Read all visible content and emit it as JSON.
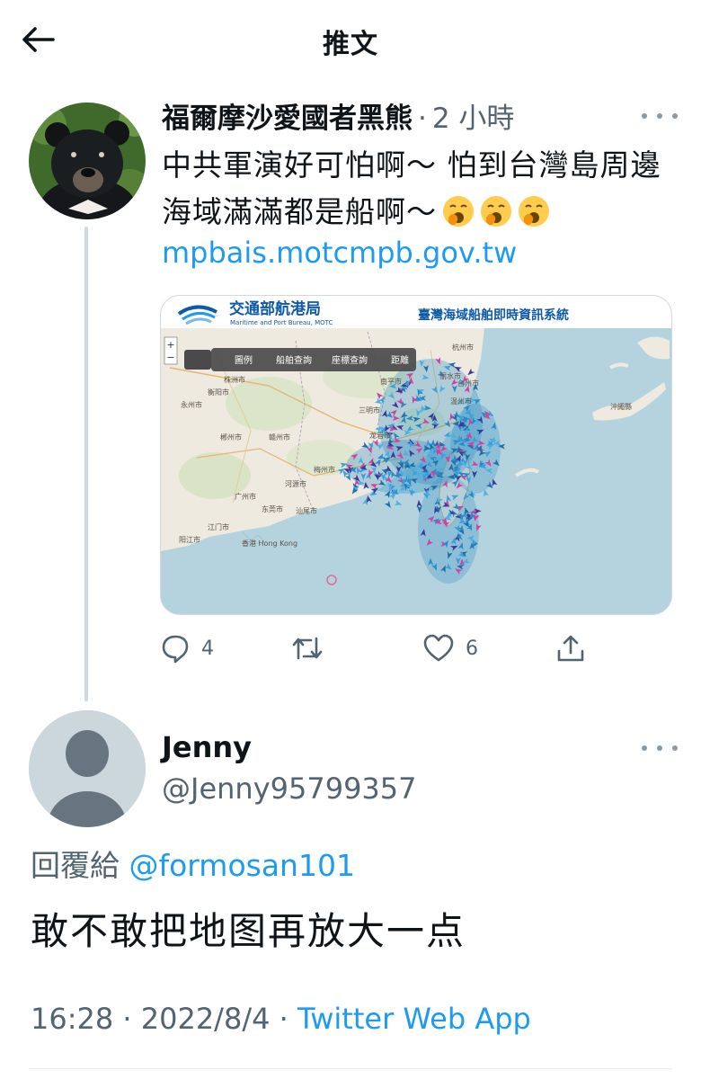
{
  "header": {
    "title": "推文"
  },
  "tweet1": {
    "author_name": "福爾摩沙愛國者黑熊",
    "separator": "·",
    "time_ago": "2 小時",
    "text": "中共軍演好可怕啊～ 怕到台灣島周邊海域滿滿都是船啊～",
    "emoji": [
      "yawning-face",
      "yawning-face",
      "yawning-face"
    ],
    "link": "mpbais.motcmpb.gov.tw",
    "card": {
      "bureau_name": "交通部航港局",
      "bureau_en": "Maritime and Port Bureau, MOTC",
      "system_title": "臺灣海域船舶即時資訊系統",
      "toolbar": [
        "圖例",
        "船舶查詢",
        "座標查詢",
        "距離"
      ],
      "zoom_in": "+",
      "zoom_out": "−",
      "city_labels": {
        "hangzhou": "杭州市",
        "taizhou": "台州市",
        "wenzhou": "温州市",
        "lishui": "丽水市",
        "zhuzhou": "株洲市",
        "hengyang": "衡阳市",
        "yongzhou": "永州市",
        "chenzhou": "郴州市",
        "ganzhou": "赣州市",
        "longyan": "龙岩市",
        "sanming": "三明市",
        "nanping": "南平市",
        "meizhou": "梅州市",
        "heyuan": "河源市",
        "guangzhou": "广州市",
        "dongguan": "东莞市",
        "shanwei": "汕尾市",
        "jiangmen": "江门市",
        "yangjiang": "阳江市",
        "hongkong": "香港 Hong Kong",
        "okinawa": "沖繩縣"
      }
    },
    "actions": {
      "replies": "4",
      "likes": "6"
    }
  },
  "tweet2": {
    "author_name": "Jenny",
    "handle": "@Jenny95799357",
    "reply_prefix": "回覆給",
    "reply_to": "@formosan101",
    "text": "敢不敢把地图再放大一点",
    "timestamp": "16:28 · 2022/8/4 · ",
    "source": "Twitter Web App"
  },
  "colors": {
    "accent": "#1d9bf0",
    "secondary_text": "#536471",
    "thread_line": "#cfd9de"
  }
}
